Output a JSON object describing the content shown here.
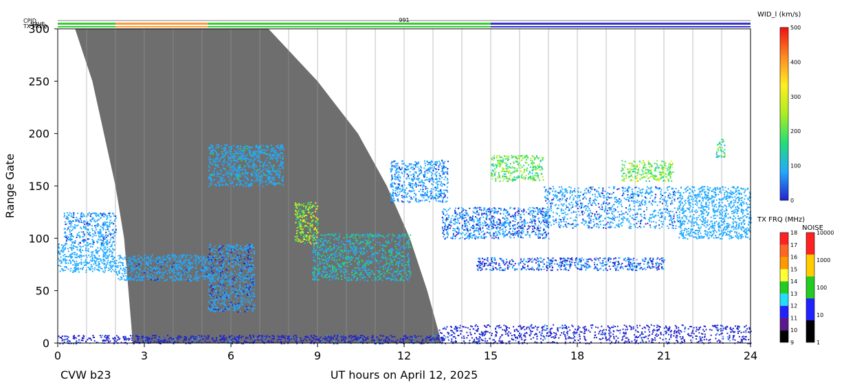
{
  "chart_data": {
    "type": "heatmap",
    "station": "CVW b23",
    "xlabel": "UT hours on April 12, 2025",
    "ylabel": "Range Gate",
    "xlim": [
      0,
      24
    ],
    "ylim": [
      0,
      300
    ],
    "x_ticks": [
      0,
      3,
      6,
      9,
      12,
      15,
      18,
      21,
      24
    ],
    "y_ticks": [
      0,
      50,
      100,
      150,
      200,
      250,
      300
    ],
    "grid": "vertical lines every hour",
    "status_rows": {
      "cpid_label": "CPID",
      "nave_label": "NAVE",
      "txfreq_label": "TX FREQ",
      "cpid_value": "991",
      "cpid_segments": [
        {
          "from": 0,
          "to": 2,
          "color": "#33cc33"
        },
        {
          "from": 2,
          "to": 5.2,
          "color": "#ff9933"
        },
        {
          "from": 5.2,
          "to": 15,
          "color": "#33cc33"
        },
        {
          "from": 15,
          "to": 24,
          "color": "#3333cc"
        }
      ]
    },
    "ground_scatter_region": {
      "color": "#6e6e6e",
      "left_edge": [
        [
          0.6,
          300
        ],
        [
          1.2,
          250
        ],
        [
          1.6,
          200
        ],
        [
          2.0,
          150
        ],
        [
          2.3,
          100
        ],
        [
          2.45,
          50
        ],
        [
          2.6,
          0
        ]
      ],
      "right_edge": [
        [
          7.3,
          300
        ],
        [
          9.0,
          250
        ],
        [
          10.4,
          200
        ],
        [
          11.4,
          150
        ],
        [
          12.2,
          100
        ],
        [
          12.8,
          50
        ],
        [
          13.3,
          0
        ]
      ]
    },
    "scatter_blobs": [
      {
        "x": [
          0.0,
          2.0
        ],
        "y": [
          68,
          95
        ],
        "level": 80
      },
      {
        "x": [
          0.2,
          2.0
        ],
        "y": [
          95,
          125
        ],
        "level": 60
      },
      {
        "x": [
          2.0,
          5.2
        ],
        "y": [
          60,
          85
        ],
        "level": 70
      },
      {
        "x": [
          5.2,
          6.8
        ],
        "y": [
          30,
          95
        ],
        "level": 60
      },
      {
        "x": [
          8.2,
          9.0
        ],
        "y": [
          95,
          135
        ],
        "level": 250
      },
      {
        "x": [
          8.8,
          12.2
        ],
        "y": [
          60,
          105
        ],
        "level": 110
      },
      {
        "x": [
          13.3,
          17.0
        ],
        "y": [
          100,
          130
        ],
        "level": 50
      },
      {
        "x": [
          14.5,
          21.0
        ],
        "y": [
          70,
          82
        ],
        "level": 40
      },
      {
        "x": [
          15.0,
          16.8
        ],
        "y": [
          155,
          180
        ],
        "level": 200
      },
      {
        "x": [
          16.8,
          21.5
        ],
        "y": [
          110,
          150
        ],
        "level": 60
      },
      {
        "x": [
          19.5,
          21.3
        ],
        "y": [
          155,
          175
        ],
        "level": 220
      },
      {
        "x": [
          21.5,
          24.0
        ],
        "y": [
          100,
          150
        ],
        "level": 80
      },
      {
        "x": [
          22.8,
          23.1
        ],
        "y": [
          178,
          195
        ],
        "level": 180
      },
      {
        "x": [
          5.2,
          7.8
        ],
        "y": [
          150,
          190
        ],
        "level": 90
      },
      {
        "x": [
          11.5,
          13.5
        ],
        "y": [
          135,
          175
        ],
        "level": 60
      },
      {
        "x": [
          13.2,
          24.0
        ],
        "y": [
          0,
          18
        ],
        "level": 30
      },
      {
        "x": [
          0.0,
          13.3
        ],
        "y": [
          0,
          8
        ],
        "level": 30
      }
    ],
    "colorbars": [
      {
        "title": "WID_l (km/s)",
        "type": "continuous",
        "min": 0,
        "max": 500,
        "ticks": [
          "0",
          "100",
          "200",
          "300",
          "400",
          "500"
        ],
        "stops": [
          "#2222cc",
          "#22aaff",
          "#22dd77",
          "#aaee22",
          "#ffee22",
          "#ff8822",
          "#ee1111"
        ]
      },
      {
        "title": "TX FRQ (MHz)",
        "type": "discrete",
        "ticks": [
          "9",
          "10",
          "11",
          "12",
          "13",
          "14",
          "15",
          "16",
          "17",
          "18"
        ],
        "colors": [
          "#000000",
          "#5a1a8c",
          "#2222ff",
          "#22ddff",
          "#22cc22",
          "#ffff33",
          "#ff9900",
          "#ff6622",
          "#ff2222"
        ]
      },
      {
        "title": "NOISE",
        "type": "discrete",
        "ticks": [
          "1",
          "10",
          "100",
          "1000",
          "10000"
        ],
        "colors": [
          "#000000",
          "#2222ff",
          "#22cc22",
          "#ffcc00",
          "#ff2222"
        ]
      }
    ]
  }
}
